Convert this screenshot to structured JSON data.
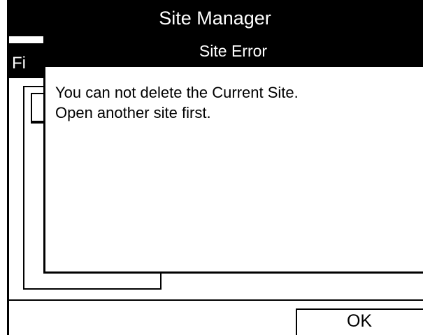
{
  "window": {
    "title": "Site Manager"
  },
  "menu": {
    "file_label_partial": "Fi"
  },
  "dialog": {
    "title": "Site Error",
    "message_lines": [
      "You can not delete the Current Site.",
      "Open another site first."
    ]
  },
  "buttons": {
    "ok_label": "OK"
  },
  "colors": {
    "title_bar": "#000000",
    "background": "#ffffff",
    "text": "#000000"
  }
}
